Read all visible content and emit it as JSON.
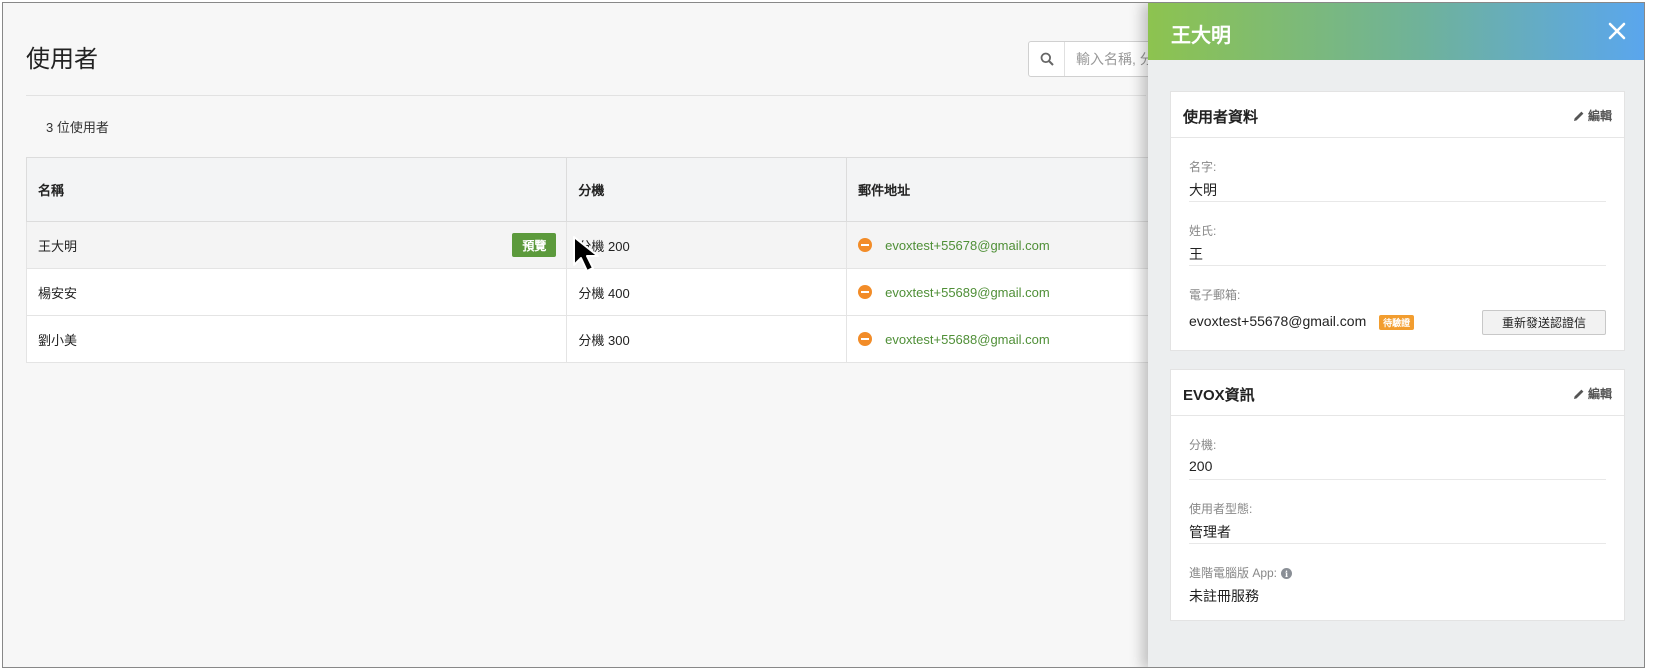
{
  "page": {
    "title": "使用者",
    "search_placeholder": "輸入名稱, 分機",
    "user_count": "3 位使用者"
  },
  "table": {
    "headers": [
      "名稱",
      "分機",
      "郵件地址"
    ],
    "rows": [
      {
        "name": "王大明",
        "extension": "分機 200",
        "email": "evoxtest+55678@gmail.com"
      },
      {
        "name": "楊安安",
        "extension": "分機 400",
        "email": "evoxtest+55689@gmail.com"
      },
      {
        "name": "劉小美",
        "extension": "分機 300",
        "email": "evoxtest+55688@gmail.com"
      }
    ],
    "preview_label": "預覽"
  },
  "panel": {
    "title": "王大明",
    "profile_card": {
      "title": "使用者資料",
      "edit_label": "編輯",
      "first_name_label": "名字:",
      "first_name": "大明",
      "last_name_label": "姓氏:",
      "last_name": "王",
      "email_label": "電子郵箱:",
      "email": "evoxtest+55678@gmail.com",
      "pending_badge": "待驗證",
      "resend_label": "重新發送認證信"
    },
    "evox_card": {
      "title": "EVOX資訊",
      "edit_label": "編輯",
      "extension_label": "分機:",
      "extension": "200",
      "user_type_label": "使用者型態:",
      "user_type": "管理者",
      "desktop_app_label": "進階電腦版 App:",
      "desktop_app": "未註冊服務"
    }
  },
  "colors": {
    "accent_green": "#5c9a3c",
    "status_orange": "#f28c28",
    "header_gradient_start": "#8dc34f",
    "header_gradient_end": "#5aa6ee"
  }
}
